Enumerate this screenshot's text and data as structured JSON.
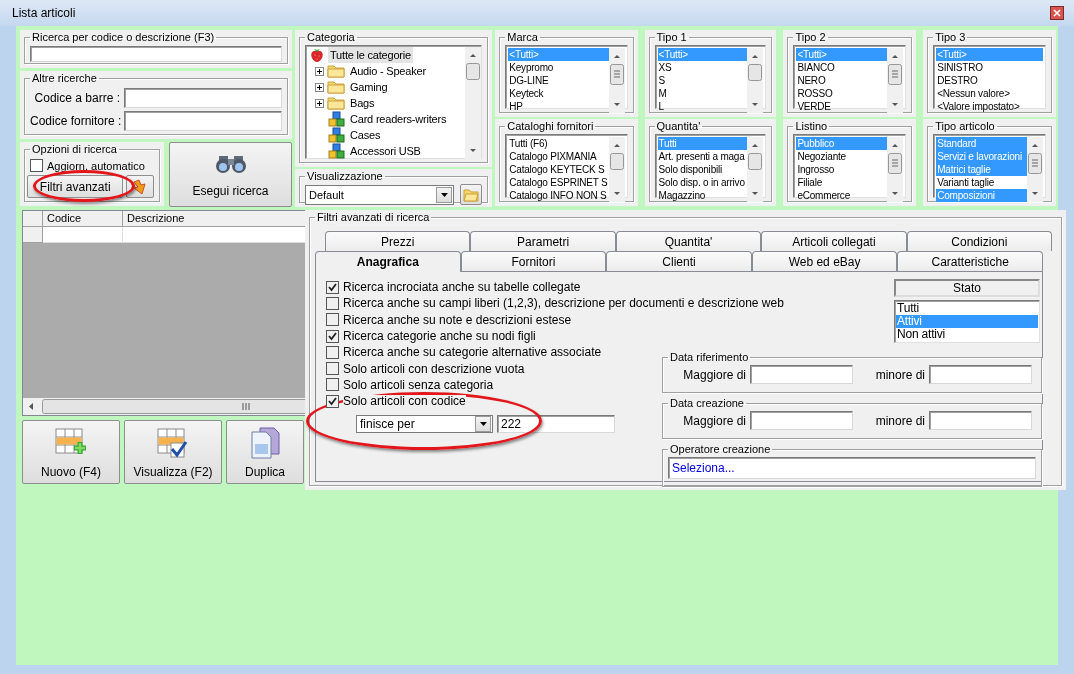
{
  "window": {
    "title": "Lista articoli"
  },
  "code_search": {
    "title": "Ricerca per codice o descrizione (F3)"
  },
  "other_searches": {
    "title": "Altre ricerche",
    "fields": [
      {
        "label": "Codice a barre :"
      },
      {
        "label": "Codice fornitore :"
      }
    ]
  },
  "search_options": {
    "title": "Opzioni di ricerca",
    "auto_update": {
      "label": "Aggiorn. automatico",
      "checked": false
    },
    "advanced_button": "Filtri avanzati"
  },
  "run_search_button": "Esegui ricerca",
  "category": {
    "title": "Categoria",
    "tree": [
      {
        "label": "Tutte le categorie",
        "kind": "root",
        "selected": true,
        "children": [
          {
            "label": "Audio - Speaker",
            "kind": "folder",
            "expanded": false,
            "selected": false
          },
          {
            "label": "Gaming",
            "kind": "folder",
            "expanded": false,
            "selected": false
          },
          {
            "label": "Bags",
            "kind": "folder",
            "expanded": false,
            "selected": false
          },
          {
            "label": "Card readers-writers",
            "kind": "leaf",
            "selected": false
          },
          {
            "label": "Cases",
            "kind": "leaf",
            "selected": false
          },
          {
            "label": "Accessori USB",
            "kind": "leaf",
            "selected": false
          }
        ]
      }
    ]
  },
  "view": {
    "title": "Visualizzazione",
    "value": "Default"
  },
  "lists": [
    {
      "title": "Marca",
      "scrollable": true,
      "items": [
        {
          "label": "<Tutti>",
          "selected": true
        },
        {
          "label": "Keypromo",
          "selected": false
        },
        {
          "label": "DG-LINE",
          "selected": false
        },
        {
          "label": "Keyteck",
          "selected": false
        },
        {
          "label": "HP",
          "selected": false
        }
      ]
    },
    {
      "title": "Tipo 1",
      "scrollable": true,
      "items": [
        {
          "label": "<Tutti>",
          "selected": true
        },
        {
          "label": "XS",
          "selected": false
        },
        {
          "label": "S",
          "selected": false
        },
        {
          "label": "M",
          "selected": false
        },
        {
          "label": "L",
          "selected": false
        }
      ]
    },
    {
      "title": "Tipo 2",
      "scrollable": true,
      "items": [
        {
          "label": "<Tutti>",
          "selected": true
        },
        {
          "label": "BIANCO",
          "selected": false
        },
        {
          "label": "NERO",
          "selected": false
        },
        {
          "label": "ROSSO",
          "selected": false
        },
        {
          "label": "VERDE",
          "selected": false
        }
      ]
    },
    {
      "title": "Tipo 3",
      "scrollable": false,
      "items": [
        {
          "label": "<Tutti>",
          "selected": true
        },
        {
          "label": "SINISTRO",
          "selected": false
        },
        {
          "label": "DESTRO",
          "selected": false
        },
        {
          "label": "<Nessun valore>",
          "selected": false
        },
        {
          "label": "<Valore impostato>",
          "selected": false
        }
      ]
    },
    {
      "title": "Cataloghi fornitori",
      "scrollable": true,
      "items": [
        {
          "label": "Tutti (F6)",
          "selected": false
        },
        {
          "label": "Catalogo PIXMANIA",
          "selected": false
        },
        {
          "label": "Catalogo KEYTECK S",
          "selected": false
        },
        {
          "label": "Catalogo ESPRINET S",
          "selected": false
        },
        {
          "label": "Catalogo INFO NON S",
          "selected": false
        }
      ]
    },
    {
      "title": "Quantita'",
      "scrollable": true,
      "items": [
        {
          "label": "Tutti",
          "selected": true
        },
        {
          "label": "Art. presenti a maga",
          "selected": false
        },
        {
          "label": "Solo disponibili",
          "selected": false
        },
        {
          "label": "Solo disp. o in arrivo",
          "selected": false
        },
        {
          "label": "Magazzino",
          "selected": false
        }
      ]
    },
    {
      "title": "Listino",
      "scrollable": true,
      "items": [
        {
          "label": "Pubblico",
          "selected": true
        },
        {
          "label": "Negoziante",
          "selected": false
        },
        {
          "label": "Ingrosso",
          "selected": false
        },
        {
          "label": "Filiale",
          "selected": false
        },
        {
          "label": "eCommerce",
          "selected": false
        }
      ]
    },
    {
      "title": "Tipo articolo",
      "scrollable": true,
      "items": [
        {
          "label": "Standard",
          "selected": true
        },
        {
          "label": "Servizi e lavorazioni",
          "selected": true
        },
        {
          "label": "Matrici taglie",
          "selected": true
        },
        {
          "label": "Varianti taglie",
          "selected": false
        },
        {
          "label": "Composizioni",
          "selected": true
        }
      ]
    }
  ],
  "table": {
    "columns": [
      "Codice",
      "Descrizione"
    ]
  },
  "actions": [
    {
      "label": "Nuovo (F4)",
      "kind": "new"
    },
    {
      "label": "Visualizza (F2)",
      "kind": "view"
    },
    {
      "label": "Duplica",
      "kind": "duplicate"
    }
  ],
  "advanced_filters": {
    "title": "Filtri avanzati di ricerca",
    "tab_rows": [
      {
        "tabs": [
          {
            "label": "Prezzi",
            "selected": false
          },
          {
            "label": "Parametri",
            "selected": false
          },
          {
            "label": "Quantita'",
            "selected": false
          },
          {
            "label": "Articoli collegati",
            "selected": false
          },
          {
            "label": "Condizioni",
            "selected": false
          }
        ]
      },
      {
        "tabs": [
          {
            "label": "Anagrafica",
            "selected": true
          },
          {
            "label": "Fornitori",
            "selected": false
          },
          {
            "label": "Clienti",
            "selected": false
          },
          {
            "label": "Web ed eBay",
            "selected": false
          },
          {
            "label": "Caratteristiche",
            "selected": false
          }
        ]
      }
    ],
    "options": [
      {
        "label": "Ricerca incrociata anche su tabelle collegate",
        "checked": true
      },
      {
        "label": "Ricerca anche su campi liberi (1,2,3), descrizione per documenti e descrizione web",
        "checked": false
      },
      {
        "label": "Ricerca anche su note e descrizioni estese",
        "checked": false
      },
      {
        "label": "Ricerca categorie anche su nodi figli",
        "checked": true
      },
      {
        "label": "Ricerca anche su categorie alternative associate",
        "checked": false
      },
      {
        "label": "Solo articoli con descrizione vuota",
        "checked": false
      },
      {
        "label": "Solo articoli senza categoria",
        "checked": false
      },
      {
        "label": "Solo articoli con codice",
        "checked": true
      }
    ],
    "code_filter": {
      "mode": "finisce per",
      "value": "222"
    },
    "status": {
      "header": "Stato",
      "items": [
        {
          "label": "Tutti",
          "selected": false
        },
        {
          "label": "Attivi",
          "selected": true
        },
        {
          "label": "Non attivi",
          "selected": false
        }
      ]
    },
    "date_ranges": [
      {
        "title": "Data riferimento",
        "from_label": "Maggiore di",
        "to_label": "minore di"
      },
      {
        "title": "Data creazione",
        "from_label": "Maggiore di",
        "to_label": "minore di"
      }
    ],
    "creator": {
      "title": "Operatore creazione",
      "value": "Seleziona..."
    }
  }
}
